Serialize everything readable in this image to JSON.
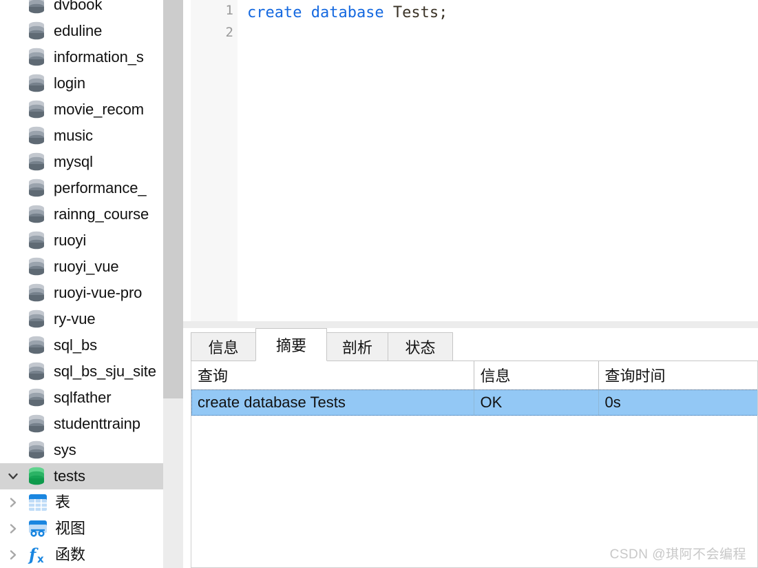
{
  "sidebar": {
    "databases": [
      {
        "name": "dvbook",
        "icon": "database-icon",
        "color": "gray",
        "selected": false
      },
      {
        "name": "eduline",
        "icon": "database-icon",
        "color": "gray",
        "selected": false
      },
      {
        "name": "information_s",
        "icon": "database-icon",
        "color": "gray",
        "selected": false
      },
      {
        "name": "login",
        "icon": "database-icon",
        "color": "gray",
        "selected": false
      },
      {
        "name": "movie_recom",
        "icon": "database-icon",
        "color": "gray",
        "selected": false
      },
      {
        "name": "music",
        "icon": "database-icon",
        "color": "gray",
        "selected": false
      },
      {
        "name": "mysql",
        "icon": "database-icon",
        "color": "gray",
        "selected": false
      },
      {
        "name": "performance_",
        "icon": "database-icon",
        "color": "gray",
        "selected": false
      },
      {
        "name": "rainng_course",
        "icon": "database-icon",
        "color": "gray",
        "selected": false
      },
      {
        "name": "ruoyi",
        "icon": "database-icon",
        "color": "gray",
        "selected": false
      },
      {
        "name": "ruoyi_vue",
        "icon": "database-icon",
        "color": "gray",
        "selected": false
      },
      {
        "name": "ruoyi-vue-pro",
        "icon": "database-icon",
        "color": "gray",
        "selected": false
      },
      {
        "name": "ry-vue",
        "icon": "database-icon",
        "color": "gray",
        "selected": false
      },
      {
        "name": "sql_bs",
        "icon": "database-icon",
        "color": "gray",
        "selected": false
      },
      {
        "name": "sql_bs_sju_site",
        "icon": "database-icon",
        "color": "gray",
        "selected": false
      },
      {
        "name": "sqlfather",
        "icon": "database-icon",
        "color": "gray",
        "selected": false
      },
      {
        "name": "studenttrainp",
        "icon": "database-icon",
        "color": "gray",
        "selected": false
      },
      {
        "name": "sys",
        "icon": "database-icon",
        "color": "gray",
        "selected": false
      },
      {
        "name": "tests",
        "icon": "database-icon",
        "color": "green",
        "selected": true,
        "expanded": true
      }
    ],
    "tests_children": [
      {
        "name": "表",
        "icon": "table-icon",
        "expanded": false
      },
      {
        "name": "视图",
        "icon": "view-icon",
        "expanded": false
      },
      {
        "name": "函数",
        "icon": "function-fx-icon",
        "expanded": false
      }
    ]
  },
  "editor": {
    "line_numbers": [
      "1",
      "2"
    ],
    "code": {
      "keyword": "create database",
      "identifier": " Tests;"
    },
    "keyword_color": "#1569e0",
    "identifier_color": "#3a3226"
  },
  "bottom_panel": {
    "tabs": [
      {
        "label": "信息",
        "active": false
      },
      {
        "label": "摘要",
        "active": true
      },
      {
        "label": "剖析",
        "active": false
      },
      {
        "label": "状态",
        "active": false
      }
    ],
    "table": {
      "columns": [
        "查询",
        "信息",
        "查询时间"
      ],
      "rows": [
        {
          "cells": [
            "create database Tests",
            "OK",
            "0s"
          ],
          "selected": true
        }
      ],
      "selected_row_color": "#93c8f5"
    }
  },
  "watermark": {
    "text": "CSDN @琪阿不会编程"
  }
}
